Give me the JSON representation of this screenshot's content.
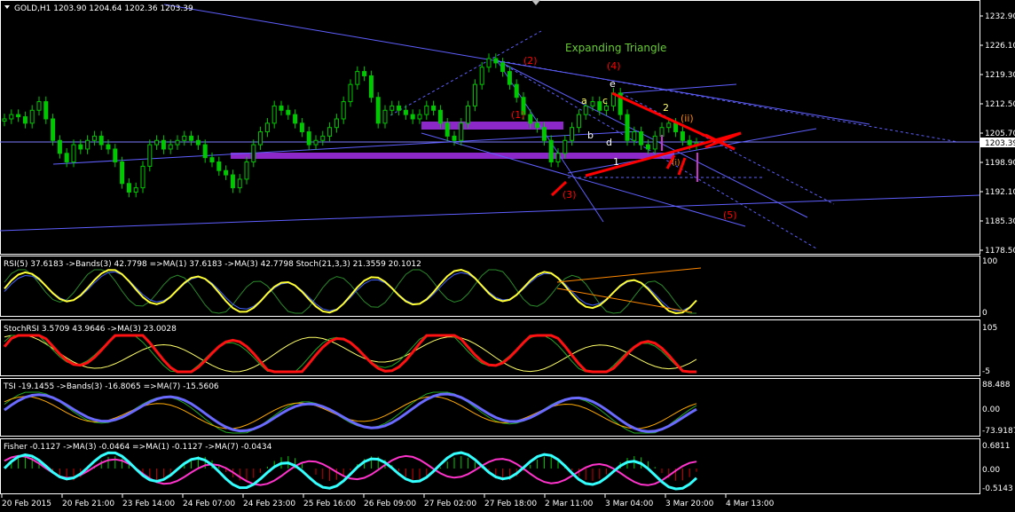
{
  "colors": {
    "background": "#000000",
    "frame": "#ffffff",
    "bull_candle": "#00c800",
    "trendline": "#5f5fff",
    "annotation_red": "#ff0000",
    "zone_purple": "#8c28c8",
    "title_green": "#66cc33",
    "wave_yellow": "#ffff66"
  },
  "main": {
    "symbol_header": "GOLD,H1  1203.90 1204.64 1202.36 1203.39",
    "current_price": "1203.39",
    "title": "Expanding Triangle",
    "price_labels": [
      "1232.90",
      "1226.10",
      "1219.30",
      "1212.50",
      "1205.70",
      "1198.90",
      "1192.10",
      "1185.30",
      "1178.50"
    ],
    "wave_labels": {
      "w1": "(1)",
      "w2": "(2)",
      "w3": "(3)",
      "w4": "(4)",
      "w5": "(5)",
      "a": "a",
      "b": "b",
      "c": "c",
      "d": "d",
      "e": "e",
      "sub1": "1",
      "sub2": "2",
      "ii": "(ii)",
      "i": "(i)"
    }
  },
  "indicators": [
    {
      "header": "RSI(5) 37.6183  ->Bands(3) 42.7798  =>MA(1) 37.6183  ->MA(3) 42.7798  Stoch(21,3,3) 21.3559 20.1012",
      "scale_top": "100",
      "scale_bottom": "0"
    },
    {
      "header": "StochRSI 3.5709 43.9646  ->MA(3) 23.0028",
      "scale_top": "105",
      "scale_bottom": "-5"
    },
    {
      "header": "TSI -19.1455  ->Bands(3) -16.8065  =>MA(7) -15.5606",
      "scale_top": "88.488",
      "scale_mid": "0.00",
      "scale_bottom": "-73.9187"
    },
    {
      "header": "Fisher -0.1127  ->MA(3) -0.0464  =>MA(1) -0.1127  ->MA(7) -0.0434",
      "scale_top": "0.6811",
      "scale_mid": "0.00",
      "scale_bottom": "-0.5143"
    }
  ],
  "time_labels": [
    "20 Feb 2015",
    "20 Feb 21:00",
    "23 Feb 14:00",
    "24 Feb 07:00",
    "24 Feb 23:00",
    "25 Feb 16:00",
    "26 Feb 09:00",
    "27 Feb 02:00",
    "27 Feb 18:00",
    "2 Mar 11:00",
    "3 Mar 04:00",
    "3 Mar 20:00",
    "4 Mar 13:00"
  ],
  "chart_data": {
    "type": "candlestick",
    "title": "Expanding Triangle",
    "symbol": "GOLD,H1",
    "ohlc_last": {
      "open": 1203.9,
      "high": 1204.64,
      "low": 1202.36,
      "close": 1203.39
    },
    "ylim": [
      1178.5,
      1232.9
    ],
    "closes": [
      1209,
      1210,
      1209.5,
      1208,
      1211,
      1213,
      1209,
      1204,
      1201,
      1199,
      1203,
      1202,
      1204,
      1205,
      1203,
      1202,
      1199,
      1194,
      1192,
      1193,
      1198,
      1203,
      1204,
      1202,
      1203,
      1204,
      1205,
      1204,
      1203,
      1200,
      1199,
      1197,
      1196,
      1193,
      1195,
      1199,
      1203,
      1206,
      1208,
      1212,
      1211,
      1210,
      1208,
      1206,
      1203,
      1204,
      1205,
      1207,
      1209,
      1213,
      1217,
      1220,
      1219,
      1214,
      1208,
      1211,
      1212,
      1211,
      1210,
      1209,
      1210,
      1212,
      1211,
      1208,
      1205,
      1204,
      1208,
      1212,
      1217,
      1221,
      1223,
      1222,
      1220,
      1217,
      1214,
      1210,
      1208,
      1207,
      1204,
      1199,
      1201,
      1204,
      1207,
      1210,
      1212,
      1213,
      1211,
      1212,
      1215,
      1210,
      1204,
      1206,
      1203,
      1202,
      1205,
      1207,
      1208,
      1206,
      1204,
      1203,
      1203.39
    ]
  }
}
